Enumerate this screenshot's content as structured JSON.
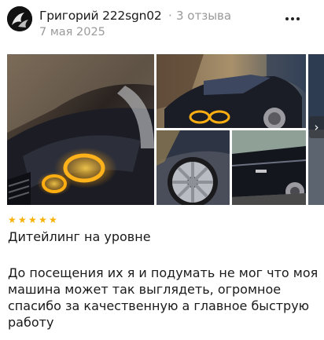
{
  "review": {
    "author": "Григорий 222sgn02",
    "separator": "·",
    "reviews_count": "3 отзыва",
    "date": "7 мая 2025",
    "rating": 5,
    "stars": [
      "★",
      "★",
      "★",
      "★",
      "★"
    ],
    "title": "Дитейлинг на уровне",
    "text_lines": [
      "До посещения их я и подумать не мог что моя",
      "машина может так выглядеть, огромное",
      "спасибо за качественную а главное быструю",
      "работу"
    ]
  },
  "icons": {
    "more": "more-dots-icon",
    "next": "chevron-right-icon",
    "star": "star-icon"
  },
  "gallery": {
    "next_glyph": "›"
  },
  "colors": {
    "star": "#f9b104",
    "muted": "#9a9a9a",
    "text": "#1a1a1a"
  }
}
